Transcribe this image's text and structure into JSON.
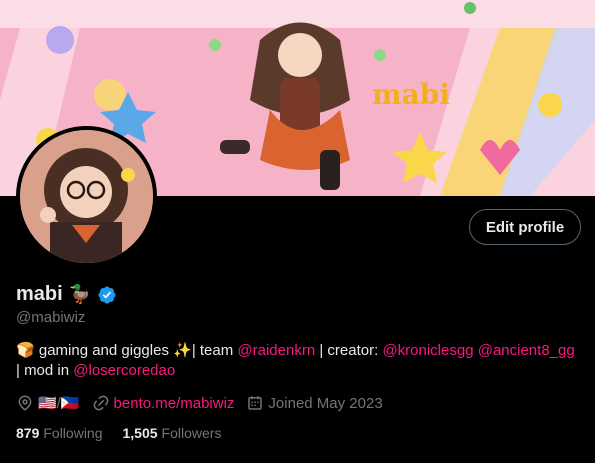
{
  "banner": {
    "text": "mabi",
    "colors": {
      "pink": "#f6b3c8",
      "light_pink": "#fbd3df",
      "yellow": "#f9d64a",
      "blue": "#5aa8e8",
      "green": "#8fd88a"
    }
  },
  "profile": {
    "display_name": "mabi",
    "name_emoji": "🦆",
    "handle": "@mabiwiz",
    "edit_button": "Edit profile",
    "bio": {
      "emoji_bread": "🍞",
      "text1": " gaming and giggles ",
      "sparkles": "✨",
      "text2": "| team ",
      "mention1": "@raidenkrn",
      "text3": " | creator: ",
      "mention2": "@kroniclesgg",
      "text4": " ",
      "mention3": "@ancient8_gg",
      "text5": "| mod in ",
      "mention4": "@losercoredao"
    },
    "location": "🇺🇸/🇵🇭",
    "website": "bento.me/mabiwiz",
    "joined": "Joined May 2023",
    "following_count": "879",
    "following_label": "Following",
    "followers_count": "1,505",
    "followers_label": "Followers"
  },
  "colors": {
    "accent": "#f91880",
    "verified": "#1d9bf0",
    "muted": "#71767b",
    "text": "#e7e9ea"
  },
  "icons": [
    "location-icon",
    "link-icon",
    "calendar-icon",
    "verified-badge-icon"
  ]
}
